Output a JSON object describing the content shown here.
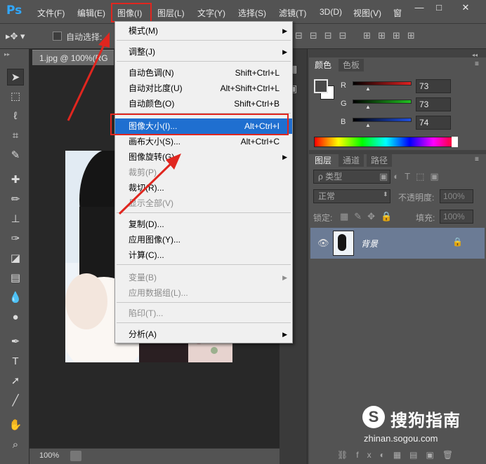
{
  "app": {
    "logo": "Ps"
  },
  "menubar": {
    "items": [
      "文件(F)",
      "编辑(E)",
      "图像(I)",
      "图层(L)",
      "文字(Y)",
      "选择(S)",
      "滤镜(T)",
      "3D(D)",
      "视图(V)",
      "窗"
    ]
  },
  "window_controls": {
    "minimize": "—",
    "restore": "□",
    "close": "✕"
  },
  "options_bar": {
    "auto_select_label": "自动选择:"
  },
  "document": {
    "tab_title": "1.jpg @ 100%(RG",
    "zoom": "100%"
  },
  "image_menu": {
    "items": [
      {
        "label": "模式(M)",
        "shortcut": "",
        "submenu": true,
        "disabled": false
      },
      {
        "label": "调整(J)",
        "shortcut": "",
        "submenu": true,
        "disabled": false
      },
      {
        "label": "自动色调(N)",
        "shortcut": "Shift+Ctrl+L",
        "submenu": false,
        "disabled": false
      },
      {
        "label": "自动对比度(U)",
        "shortcut": "Alt+Shift+Ctrl+L",
        "submenu": false,
        "disabled": false
      },
      {
        "label": "自动颜色(O)",
        "shortcut": "Shift+Ctrl+B",
        "submenu": false,
        "disabled": false
      },
      {
        "label": "图像大小(I)...",
        "shortcut": "Alt+Ctrl+I",
        "submenu": false,
        "disabled": false,
        "selected": true
      },
      {
        "label": "画布大小(S)...",
        "shortcut": "Alt+Ctrl+C",
        "submenu": false,
        "disabled": false
      },
      {
        "label": "图像旋转(G)",
        "shortcut": "",
        "submenu": true,
        "disabled": false
      },
      {
        "label": "裁剪(P)",
        "shortcut": "",
        "submenu": false,
        "disabled": true
      },
      {
        "label": "裁切(R)...",
        "shortcut": "",
        "submenu": false,
        "disabled": false
      },
      {
        "label": "显示全部(V)",
        "shortcut": "",
        "submenu": false,
        "disabled": true
      },
      {
        "label": "复制(D)...",
        "shortcut": "",
        "submenu": false,
        "disabled": false
      },
      {
        "label": "应用图像(Y)...",
        "shortcut": "",
        "submenu": false,
        "disabled": false
      },
      {
        "label": "计算(C)...",
        "shortcut": "",
        "submenu": false,
        "disabled": false
      },
      {
        "label": "变量(B)",
        "shortcut": "",
        "submenu": true,
        "disabled": true
      },
      {
        "label": "应用数据组(L)...",
        "shortcut": "",
        "submenu": false,
        "disabled": true
      },
      {
        "label": "陷印(T)...",
        "shortcut": "",
        "submenu": false,
        "disabled": true
      },
      {
        "label": "分析(A)",
        "shortcut": "",
        "submenu": true,
        "disabled": false
      }
    ]
  },
  "color_panel": {
    "tabs": [
      "颜色",
      "色板"
    ],
    "channels": [
      {
        "label": "R",
        "value": "73"
      },
      {
        "label": "G",
        "value": "73"
      },
      {
        "label": "B",
        "value": "74"
      }
    ],
    "fg_color": "#494949"
  },
  "layers_panel": {
    "tabs": [
      "图层",
      "通道",
      "路径"
    ],
    "filter_label": "ρ 类型",
    "blend_mode": "正常",
    "opacity_label": "不透明度:",
    "opacity_value": "100%",
    "lock_label": "锁定:",
    "fill_label": "填充:",
    "fill_value": "100%",
    "layer_name": "背景"
  },
  "watermark": {
    "brand": "搜狗指南",
    "url": "zhinan.sogou.com",
    "logo": "S"
  },
  "colors": {
    "accent_red": "#e0261f",
    "selection_blue": "#1f6fd0"
  }
}
